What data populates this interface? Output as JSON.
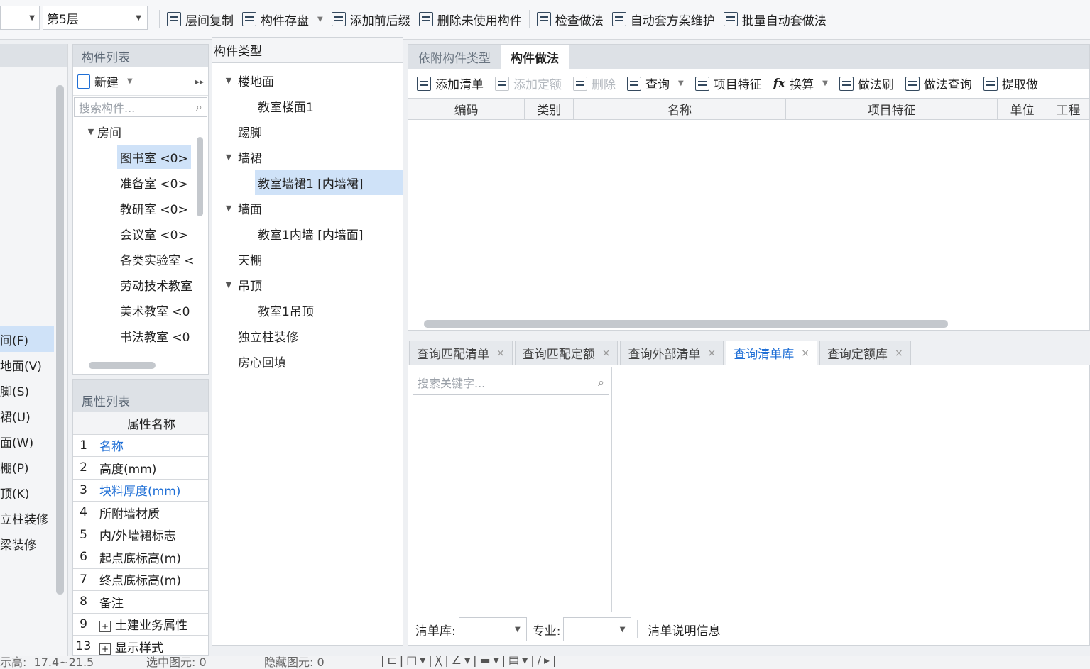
{
  "toolbar": {
    "floor_select": "第5层",
    "items": [
      "层间复制",
      "构件存盘",
      "添加前后缀",
      "删除未使用构件",
      "检查做法",
      "自动套方案维护",
      "批量自动套做法"
    ]
  },
  "left_nav": {
    "items": [
      "间(F)",
      "地面(V)",
      "脚(S)",
      "裙(U)",
      "面(W)",
      "棚(P)",
      "顶(K)",
      "立柱装修",
      "梁装修"
    ]
  },
  "component_list": {
    "title": "构件列表",
    "new_label": "新建",
    "search_placeholder": "搜索构件...",
    "group": "房间",
    "items": [
      "图书室 <0>",
      "准备室 <0>",
      "教研室 <0>",
      "会议室 <0>",
      "各类实验室 <",
      "劳动技术教室",
      "美术教室 <0",
      "书法教室 <0"
    ]
  },
  "property_list": {
    "title": "属性列表",
    "column": "属性名称",
    "rows": [
      {
        "no": "1",
        "name": "名称"
      },
      {
        "no": "2",
        "name": "高度(mm)"
      },
      {
        "no": "3",
        "name": "块料厚度(mm)"
      },
      {
        "no": "4",
        "name": "所附墙材质"
      },
      {
        "no": "5",
        "name": "内/外墙裙标志"
      },
      {
        "no": "6",
        "name": "起点底标高(m)"
      },
      {
        "no": "7",
        "name": "终点底标高(m)"
      },
      {
        "no": "8",
        "name": "备注"
      },
      {
        "no": "9",
        "name": "土建业务属性"
      },
      {
        "no": "13",
        "name": "显示样式"
      }
    ]
  },
  "type_tree": {
    "title": "构件类型",
    "nodes": [
      "楼地面",
      "教室楼面1",
      "踢脚",
      "墙裙",
      "教室墙裙1 [内墙裙]",
      "墙面",
      "教室1内墙 [内墙面]",
      "天棚",
      "吊顶",
      "教室1吊顶",
      "独立柱装修",
      "房心回填"
    ]
  },
  "main": {
    "tabs": [
      "依附构件类型",
      "构件做法"
    ],
    "actions": [
      "添加清单",
      "添加定额",
      "删除",
      "查询",
      "项目特征",
      "换算",
      "做法刷",
      "做法查询",
      "提取做"
    ],
    "columns": [
      "编码",
      "类别",
      "名称",
      "项目特征",
      "单位",
      "工程"
    ]
  },
  "query": {
    "tabs": [
      "查询匹配清单",
      "查询匹配定额",
      "查询外部清单",
      "查询清单库",
      "查询定额库"
    ],
    "search_placeholder": "搜索关键字...",
    "lib_label": "清单库:",
    "major_label": "专业:",
    "info_label": "清单说明信息"
  },
  "status": {
    "height": "示高:  17.4~21.5",
    "selected": "选中图元: 0",
    "hidden": "隐藏图元: 0"
  }
}
